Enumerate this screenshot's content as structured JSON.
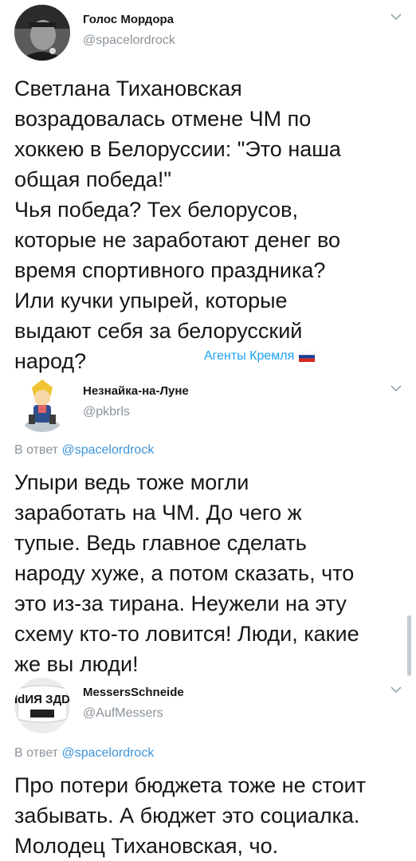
{
  "tweets": [
    {
      "author": "Голос Мордора",
      "handle": "@spacelordrock",
      "lines": [
        "Светлана Тихановская",
        "возрадовалась отмене ЧМ по",
        "хоккею в Белоруссии: \"Это наша",
        "общая победа!\"",
        "Чья победа? Тех белорусов,",
        "которые не заработают денег во",
        "время спортивного праздника?",
        "Или кучки упырей, которые",
        "выдают себя за белорусский",
        "народ?"
      ],
      "signature": "Агенты Кремля",
      "flag_colors": [
        "#ffffff",
        "#1c3f94",
        "#d52b1e"
      ]
    },
    {
      "author": "Незнайка-на-Луне",
      "handle": "@pkbrls",
      "reply_prefix": "В ответ",
      "reply_handle": "@spacelordrock",
      "lines": [
        "Упыри ведь тоже могли",
        "заработать на ЧМ. До чего ж",
        "тупые. Ведь главное сделать",
        "народу хуже, а потом сказать, что",
        "это из-за тирана. Неужели на эту",
        "схему кто-то ловится! Люди, какие",
        "же вы люди!"
      ]
    },
    {
      "author": "MessersSchneide",
      "handle": "@AufMessers",
      "reply_prefix": "В ответ",
      "reply_handle": "@spacelordrock",
      "avatar_text": "ІdИЯ ЗДD",
      "lines": [
        "Про потери бюджета тоже не стоит",
        "забывать. А бюджет это социалка.",
        "Молодец Тихановская, чо."
      ]
    }
  ],
  "icons": {
    "menu": "chevron-down-icon"
  },
  "colors": {
    "text": "#14171a",
    "muted": "#8a939b",
    "link": "#3b94d9",
    "signature": "#1da1f2"
  }
}
